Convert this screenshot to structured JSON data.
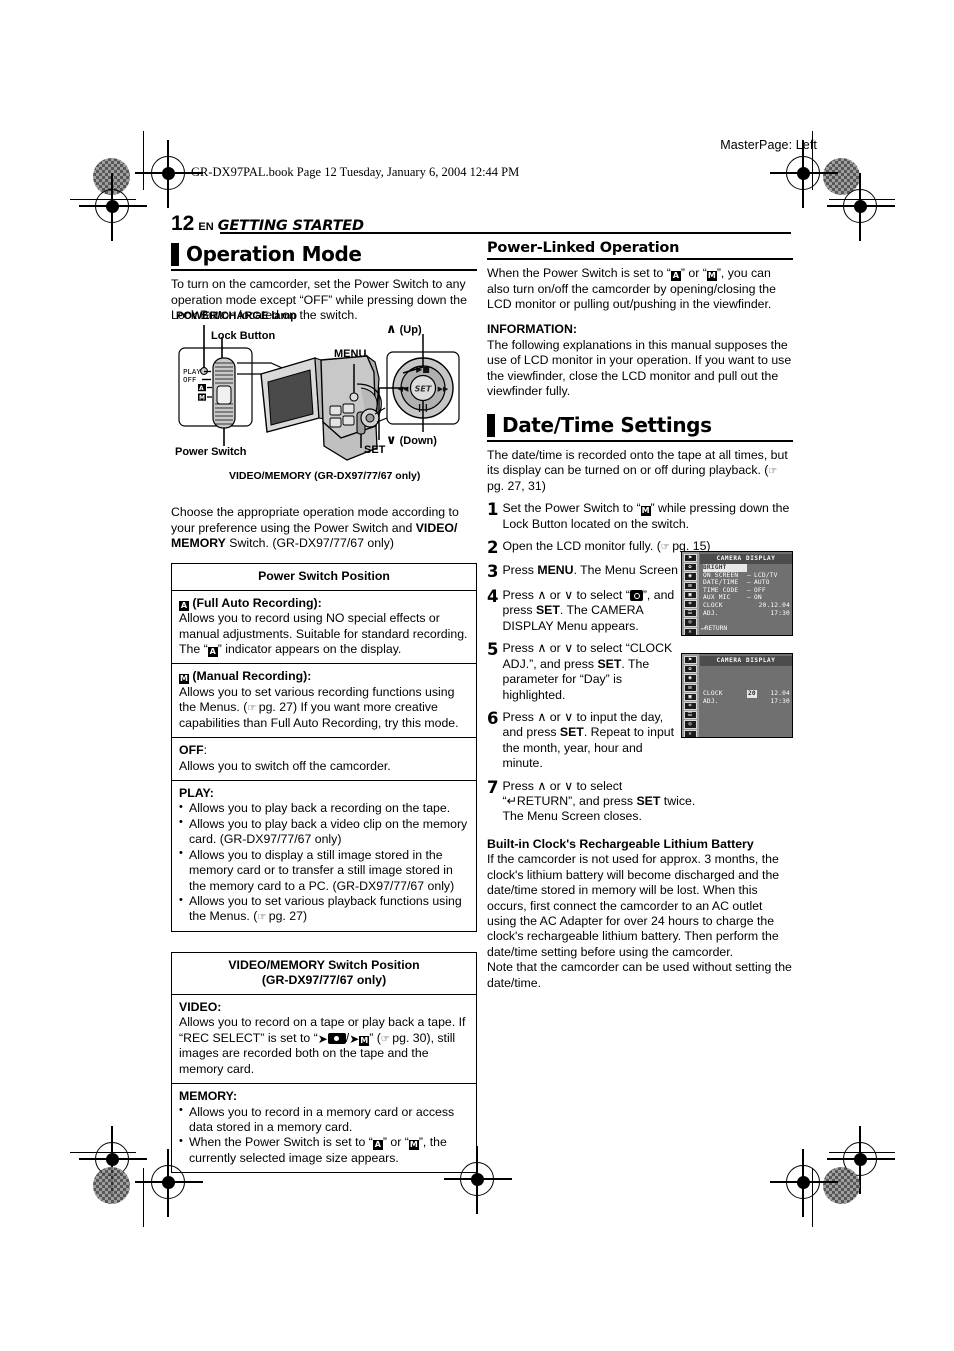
{
  "header": {
    "masterpage": "MasterPage: Left",
    "bookline": "GR-DX97PAL.book  Page 12  Tuesday, January 6, 2004  12:44 PM",
    "page_number": "12",
    "lang": "EN",
    "section": "GETTING STARTED"
  },
  "left": {
    "h1": "Operation Mode",
    "intro": "To turn on the camcorder, set the Power Switch to any operation mode except “OFF” while pressing down the Lock Button located on the switch.",
    "diagram": {
      "power_charge_lamp": "POWER/CHARGE lamp",
      "lock_button": "Lock Button",
      "menu": "MENU",
      "up": "(Up)",
      "down": "(Down)",
      "set": "SET",
      "power_switch": "Power Switch",
      "video_memory": "VIDEO/MEMORY (GR-DX97/77/67 only)",
      "switch_positions": [
        "PLAY",
        "OFF"
      ],
      "set_dial_label": "SET"
    },
    "choose_text_1": "Choose the appropriate operation mode according to your preference using the Power Switch and ",
    "choose_bold": "VIDEO/ MEMORY",
    "choose_text_2": " Switch. (GR-DX97/77/67 only)",
    "table1": {
      "header": "Power Switch Position",
      "rows": [
        {
          "title": " (Full Auto Recording):",
          "body_a": "Allows you to record using NO special effects or manual adjustments. Suitable for standard recording. The “",
          "body_b": "” indicator appears on the display."
        },
        {
          "title": " (Manual Recording):",
          "body_a": "Allows you to set various recording functions using the Menus. (",
          "pg": "pg. 27",
          "body_b": ") If you want more creative capabilities than Full Auto Recording, try this mode."
        },
        {
          "title": "OFF",
          "title_rest": ":",
          "body": "Allows you to switch off the camcorder."
        },
        {
          "title": "PLAY:",
          "bullets": [
            "Allows you to play back a recording on the tape.",
            "Allows you to play back a video clip on the memory card. (GR-DX97/77/67 only)",
            "Allows you to display a still image stored in the memory card or to transfer a still image stored in the memory card to a PC. (GR-DX97/77/67 only)",
            "Allows you to set various playback functions using the Menus. (☰ pg. 27)"
          ],
          "bullet4_a": "Allows you to set various playback functions using the Menus. (",
          "bullet4_pg": "pg. 27",
          "bullet4_b": ")"
        }
      ]
    },
    "table2": {
      "header_line1": "VIDEO/MEMORY Switch Position",
      "header_line2": "(GR-DX97/77/67 only)",
      "rows": [
        {
          "title": "VIDEO:",
          "body_a": "Allows you to record on a tape or play back a tape. If “REC SELECT” is set to “",
          "body_mid": "/",
          "body_b": "” (",
          "pg": "pg. 30",
          "body_c": "), still images are recorded both on the tape and the memory card."
        },
        {
          "title": "MEMORY:",
          "bullets": [
            "Allows you to record in a memory card or access data stored in a memory card.",
            "When the Power Switch is set to “"
          ],
          "bullet2_b": "” or “",
          "bullet2_c": "”, the currently selected image size appears."
        }
      ]
    }
  },
  "right": {
    "h2_power": "Power-Linked Operation",
    "power_a": "When the Power Switch is set to “",
    "power_b": "” or “",
    "power_c": "”, you can also turn on/off the camcorder by opening/closing the LCD monitor or pulling out/pushing in the viewfinder.",
    "info_head": "INFORMATION:",
    "info_body": "The following explanations in this manual supposes the use of LCD monitor in your operation. If you want to use the viewfinder, close the LCD monitor and pull out the viewfinder fully.",
    "h1_date": "Date/Time Settings",
    "date_intro_a": "The date/time is recorded onto the tape at all times, but its display can be turned on or off during playback. (",
    "date_intro_pg": "pg. 27, 31",
    "date_intro_b": ")",
    "steps": [
      {
        "n": "1",
        "a": "Set the Power Switch to “",
        "b": "” while pressing down the Lock Button located on the switch."
      },
      {
        "n": "2",
        "a": "Open the LCD monitor fully. (",
        "pg": "pg. 15",
        "b": ")"
      },
      {
        "n": "3",
        "a": "Press ",
        "bold": "MENU",
        "b": ". The Menu Screen appears."
      },
      {
        "n": "4",
        "a": "Press ∧ or ∨ to select “",
        "b": "”, and press ",
        "bold": "SET",
        "c": ". The CAMERA DISPLAY Menu appears."
      },
      {
        "n": "5",
        "a": "Press ∧ or ∨ to select “CLOCK ADJ.”, and press ",
        "bold": "SET",
        "b": ". The parameter for “Day” is highlighted."
      },
      {
        "n": "6",
        "a": "Press ∧ or ∨ to input the day, and press ",
        "bold": "SET",
        "b": ". Repeat to input the month, year, hour and minute."
      },
      {
        "n": "7",
        "a": "Press ∧ or ∨ to select “↵RETURN”, and press ",
        "bold": "SET",
        "b": " twice. The Menu Screen closes."
      }
    ],
    "battery_head": "Built-in Clock's Rechargeable Lithium Battery",
    "battery_body": "If the camcorder is not used for approx. 3 months, the clock's lithium battery will become discharged and the date/time stored in memory will be lost. When this occurs, first connect the camcorder to an AC outlet using the AC Adapter for over 24 hours to charge the clock's rechargeable lithium battery. Then perform the date/time setting before using the camcorder.",
    "battery_note": "Note that the camcorder can be used without setting the date/time."
  },
  "lcd1": {
    "title": "CAMERA DISPLAY",
    "highlighted_row": "BRIGHT",
    "rows": [
      {
        "key": "ON SCREEN",
        "eq": "–",
        "value": "LCD/TV"
      },
      {
        "key": "DATE/TIME",
        "eq": "–",
        "value": "AUTO"
      },
      {
        "key": "TIME CODE",
        "eq": "–",
        "value": "OFF"
      },
      {
        "key": "AUX MIC",
        "eq": "–",
        "value": "ON"
      },
      {
        "key": "CLOCK",
        "eq": "",
        "value": "20.12.04"
      },
      {
        "key": "ADJ.",
        "eq": "",
        "value": "17:30"
      }
    ],
    "return": "↵RETURN",
    "rail_icons": [
      "⚑",
      "✿",
      "◉",
      "⊞",
      "▣",
      "⌗",
      "☰",
      "◎",
      "✕"
    ]
  },
  "lcd2": {
    "title": "CAMERA DISPLAY",
    "rows": [
      {
        "key": "CLOCK",
        "hl": "20",
        "value": "12.04"
      },
      {
        "key": "ADJ.",
        "hl": "",
        "value": "17:30"
      }
    ],
    "rail_icons": [
      "⚑",
      "✿",
      "◉",
      "⊞",
      "▣",
      "⌗",
      "☰",
      "◎",
      "✕"
    ]
  },
  "colors": {
    "ink": "#000000",
    "lcd_bg": "#707070",
    "lcd_rail": "#9a9a9a"
  }
}
